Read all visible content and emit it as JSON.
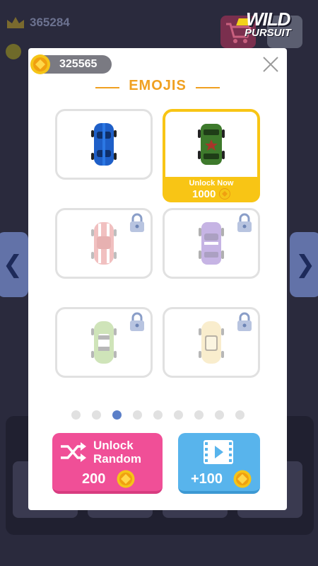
{
  "background": {
    "best_score": "365284",
    "nav_prev_glyph": "❮",
    "nav_next_glyph": "❯",
    "logo_line1": "WILD",
    "logo_line2": "PURSUIT"
  },
  "modal": {
    "coins": "325565",
    "title": "EMOJIS",
    "close_icon": "close-icon",
    "tiles": [
      {
        "car": "blue-car",
        "locked": false,
        "selected": false
      },
      {
        "car": "green-army-car",
        "locked": false,
        "selected": true,
        "unlock_label": "Unlock Now",
        "unlock_price": "1000"
      },
      {
        "car": "pink-convertible-car",
        "locked": true
      },
      {
        "car": "purple-sports-car",
        "locked": true
      },
      {
        "car": "green-white-car",
        "locked": true
      },
      {
        "car": "cream-taxi-car",
        "locked": true
      }
    ],
    "pagination": {
      "pages": 9,
      "active_index": 2
    },
    "buttons": {
      "unlock_random_label_1": "Unlock",
      "unlock_random_label_2": "Random",
      "unlock_random_price": "200",
      "video_reward": "+100"
    }
  },
  "colors": {
    "accent": "#f0a020",
    "selected": "#f8c515",
    "random_button": "#f04f97",
    "video_button": "#58b4ec",
    "active_dot": "#5b7fc8"
  }
}
